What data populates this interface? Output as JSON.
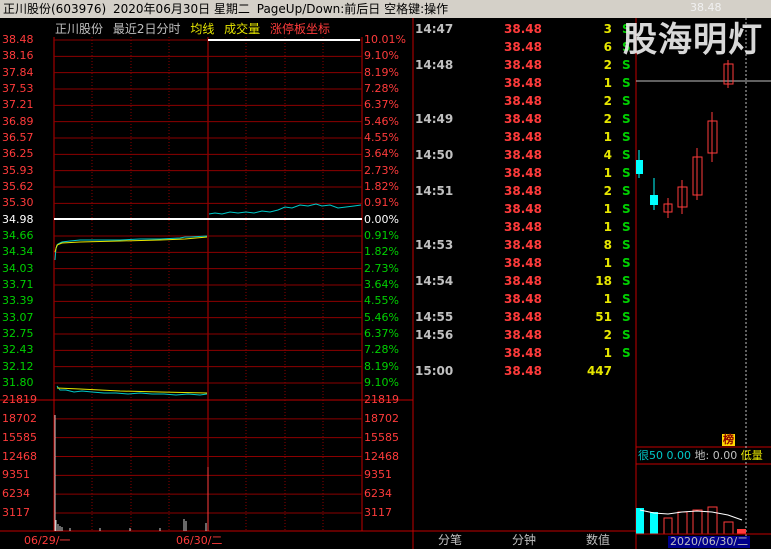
{
  "titlebar": {
    "stock": "正川股份(603976)",
    "date": "2020年06月30日 星期二",
    "hint": "PageUp/Down:前后日 空格键:操作"
  },
  "chart_header": {
    "name": "正川股份",
    "mode": "最近2日分时",
    "avg_line": "均线",
    "volume": "成交量",
    "limit_coord": "涨停板坐标"
  },
  "colors": {
    "up": "#ff3b3b",
    "down": "#00d000",
    "price": "#00c8c8",
    "avg": "#e6e600",
    "grid": "#8b0000",
    "frame": "#c00000"
  },
  "left_axis": {
    "prices": [
      "38.48",
      "38.16",
      "37.84",
      "37.53",
      "37.21",
      "36.89",
      "36.57",
      "36.25",
      "35.93",
      "35.62",
      "35.30",
      "34.98",
      "34.66",
      "34.34",
      "34.03",
      "33.71",
      "33.39",
      "33.07",
      "32.75",
      "32.43",
      "32.12",
      "31.80"
    ],
    "volumes": [
      "21819",
      "18702",
      "15585",
      "12468",
      "9351",
      "6234",
      "3117"
    ]
  },
  "right_axis": {
    "percents": [
      "10.01%",
      "9.10%",
      "8.19%",
      "7.28%",
      "6.37%",
      "5.46%",
      "4.55%",
      "3.64%",
      "2.73%",
      "1.82%",
      "0.91%",
      "0.00%",
      "0.91%",
      "1.82%",
      "2.73%",
      "3.64%",
      "4.55%",
      "5.46%",
      "6.37%",
      "7.28%",
      "8.19%",
      "9.10%"
    ],
    "volumes": [
      "21819",
      "18702",
      "15585",
      "12468",
      "9351",
      "6234",
      "3117"
    ]
  },
  "x_axis": {
    "day1": "06/29/一",
    "day2": "06/30/二"
  },
  "ticks": [
    {
      "time": "14:47",
      "price": "38.48",
      "vol": "3",
      "side": "S"
    },
    {
      "time": "",
      "price": "38.48",
      "vol": "6",
      "side": "S"
    },
    {
      "time": "14:48",
      "price": "38.48",
      "vol": "2",
      "side": "S"
    },
    {
      "time": "",
      "price": "38.48",
      "vol": "1",
      "side": "S"
    },
    {
      "time": "",
      "price": "38.48",
      "vol": "2",
      "side": "S"
    },
    {
      "time": "14:49",
      "price": "38.48",
      "vol": "2",
      "side": "S"
    },
    {
      "time": "",
      "price": "38.48",
      "vol": "1",
      "side": "S"
    },
    {
      "time": "14:50",
      "price": "38.48",
      "vol": "4",
      "side": "S"
    },
    {
      "time": "",
      "price": "38.48",
      "vol": "1",
      "side": "S"
    },
    {
      "time": "14:51",
      "price": "38.48",
      "vol": "2",
      "side": "S"
    },
    {
      "time": "",
      "price": "38.48",
      "vol": "1",
      "side": "S"
    },
    {
      "time": "",
      "price": "38.48",
      "vol": "1",
      "side": "S"
    },
    {
      "time": "14:53",
      "price": "38.48",
      "vol": "8",
      "side": "S"
    },
    {
      "time": "",
      "price": "38.48",
      "vol": "1",
      "side": "S"
    },
    {
      "time": "14:54",
      "price": "38.48",
      "vol": "18",
      "side": "S"
    },
    {
      "time": "",
      "price": "38.48",
      "vol": "1",
      "side": "S"
    },
    {
      "time": "14:55",
      "price": "38.48",
      "vol": "51",
      "side": "S"
    },
    {
      "time": "14:56",
      "price": "38.48",
      "vol": "2",
      "side": "S"
    },
    {
      "time": "",
      "price": "38.48",
      "vol": "1",
      "side": "S"
    },
    {
      "time": "15:00",
      "price": "38.48",
      "vol": "447",
      "side": ""
    }
  ],
  "tabs": [
    "分笔",
    "分钟",
    "数值"
  ],
  "mini": {
    "price_label": "38.48",
    "tag": "榜",
    "indicator": "很50",
    "indicator_val": "0.00",
    "di_label": "地:",
    "di_val": "0.00",
    "low_label": "低量",
    "date": "2020/06/30/二"
  },
  "watermark": "股海明灯"
}
